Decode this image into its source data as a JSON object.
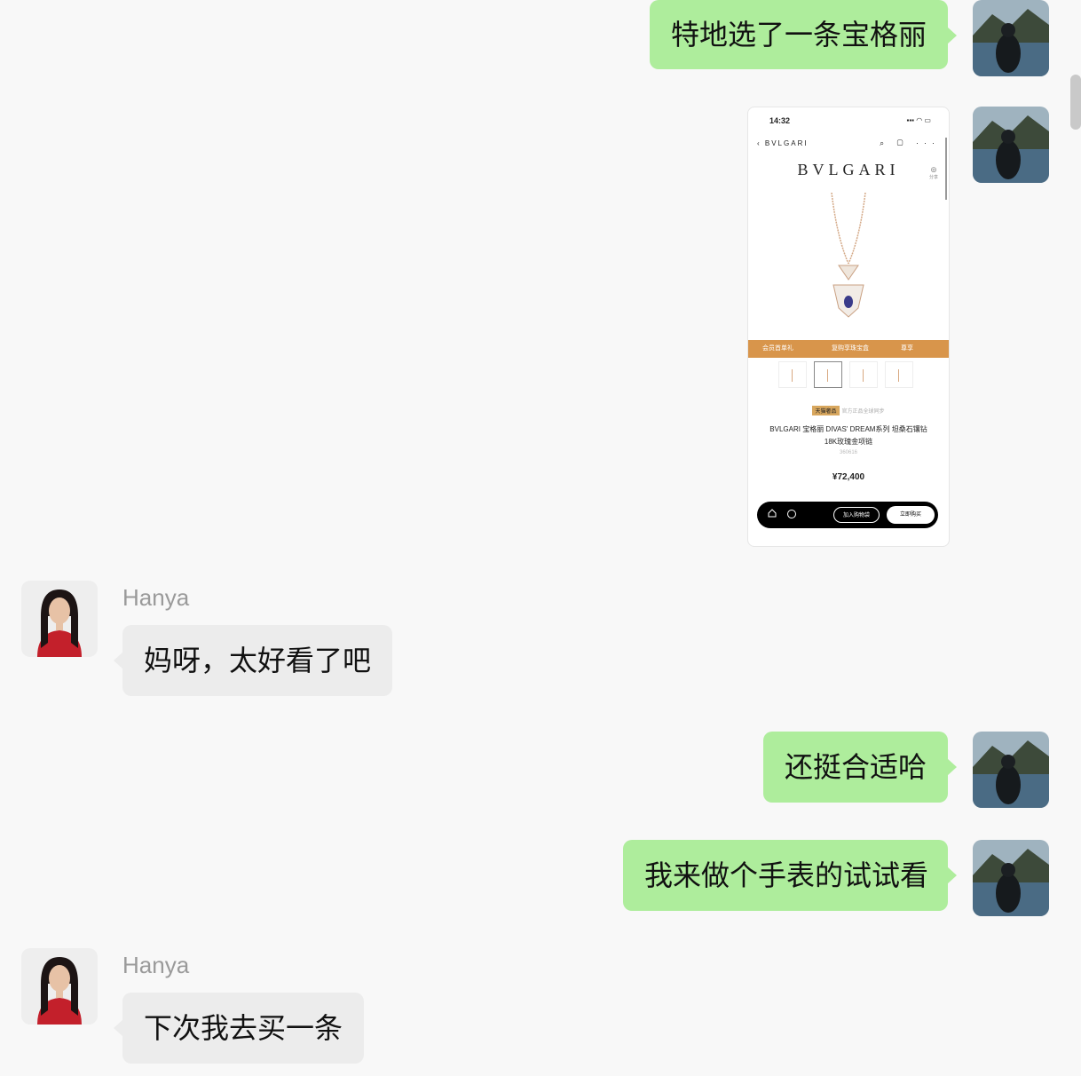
{
  "conversation": {
    "messages": [
      {
        "id": "m1",
        "sender": "me",
        "type": "text",
        "text": "特地选了一条宝格丽"
      },
      {
        "id": "m2",
        "sender": "me",
        "type": "image"
      },
      {
        "id": "m3",
        "sender": "them",
        "type": "text",
        "name": "Hanya",
        "text": "妈呀，太好看了吧"
      },
      {
        "id": "m4",
        "sender": "me",
        "type": "text",
        "text": "还挺合适哈"
      },
      {
        "id": "m5",
        "sender": "me",
        "type": "text",
        "text": "我来做个手表的试试看"
      },
      {
        "id": "m6",
        "sender": "them",
        "type": "text",
        "name": "Hanya",
        "text": "下次我去买一条"
      }
    ]
  },
  "product_screenshot": {
    "status_time": "14:32",
    "status_icons": "▪▪▪ ◠ ▭",
    "nav_back": "‹ BVLGARI",
    "nav_icons": "⌕ ▢ ···",
    "brand": "BVLGARI",
    "share_icon": "⊚",
    "share_label": "分享",
    "promo": [
      "会员首单礼",
      "复购享珠宝盒",
      "尊享"
    ],
    "badge": "天猫奢品",
    "badge_note": "官方正品全球同步",
    "product_name_line1": "BVLGARI 宝格丽 DIVAS' DREAM系列 坦桑石镶钻",
    "product_name_line2": "18K玫瑰金项链",
    "sku": "360616",
    "price": "¥72,400",
    "add_to_bag": "加入购物袋",
    "buy_now": "立即购买"
  },
  "colors": {
    "background": "#f8f8f8",
    "my_bubble": "#aeed9c",
    "their_bubble": "#ececec",
    "promo_bar": "#d8954b",
    "sender_name": "#9a9a9a"
  }
}
